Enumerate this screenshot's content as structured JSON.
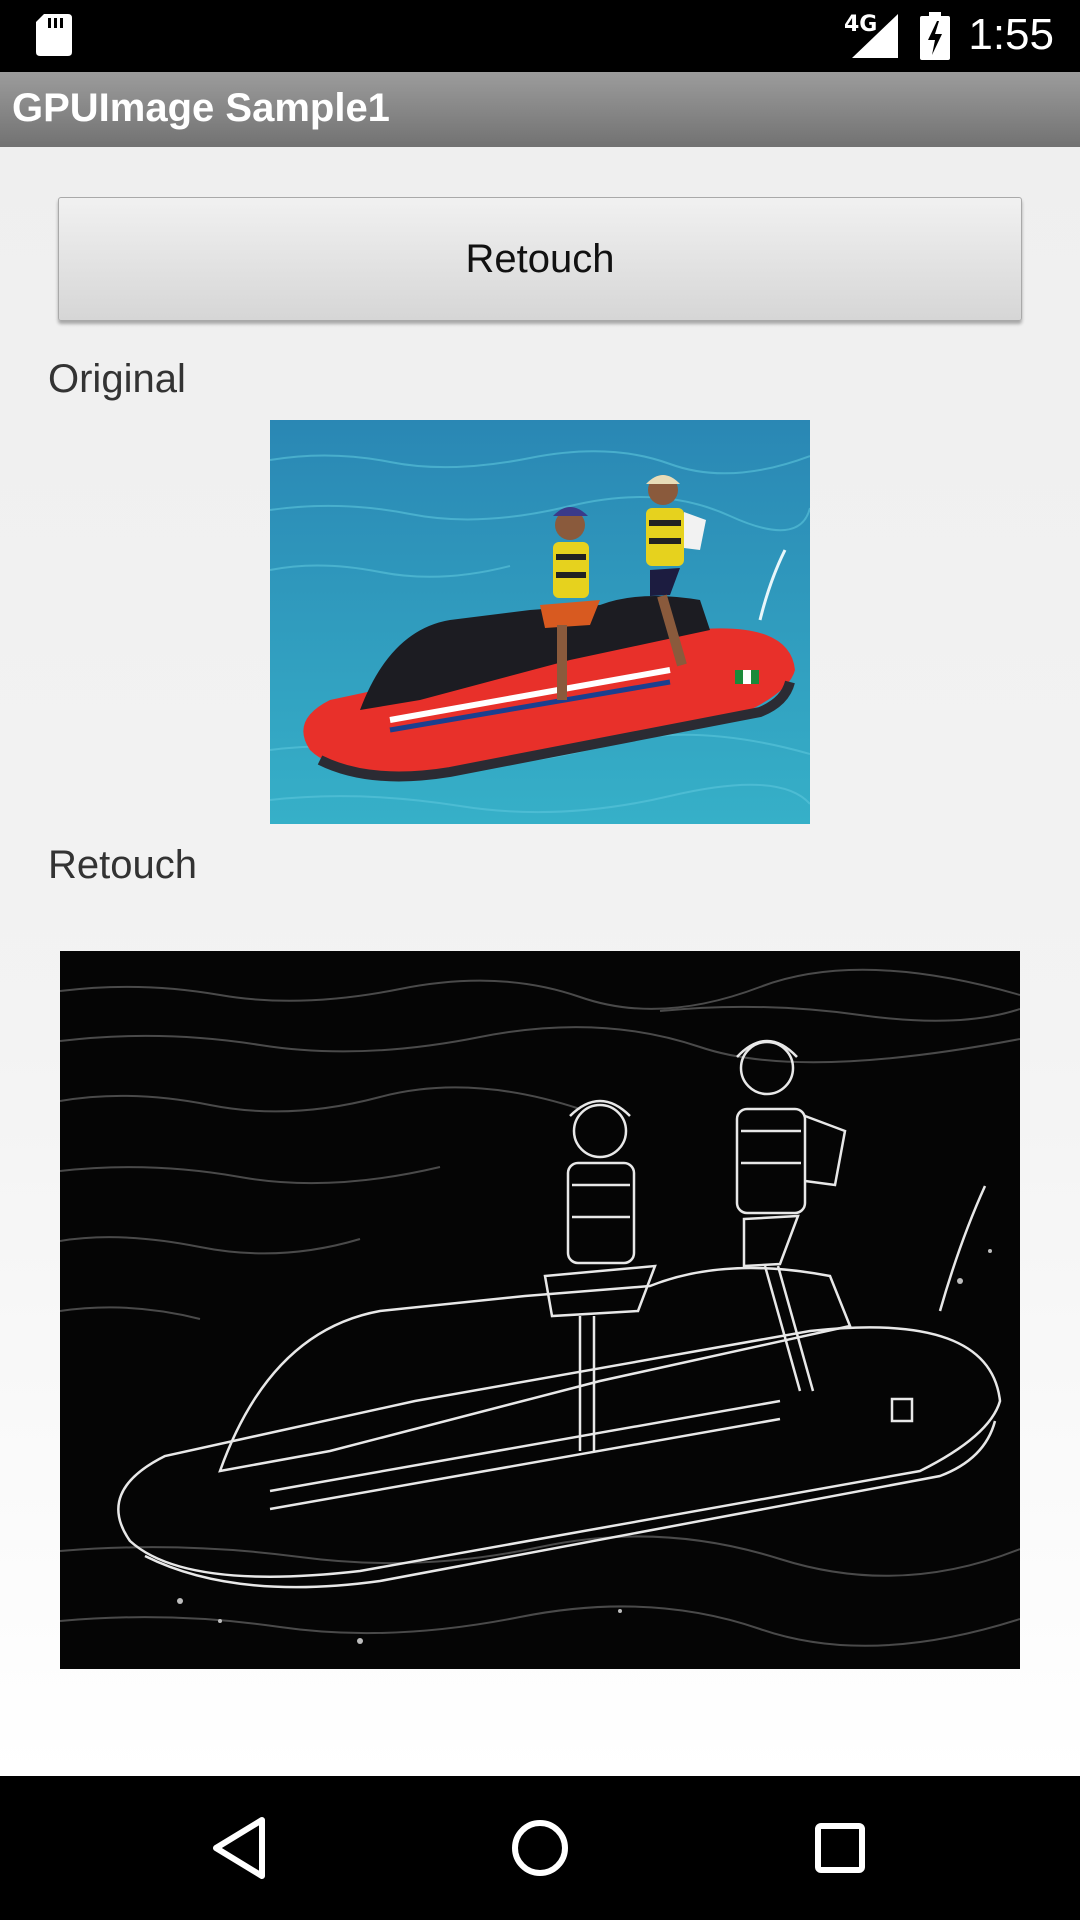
{
  "status_bar": {
    "network": "4G",
    "time": "1:55",
    "icons": [
      "sd-card-icon",
      "signal-icon",
      "battery-charging-icon"
    ]
  },
  "action_bar": {
    "title": "GPUImage Sample1"
  },
  "main": {
    "retouch_button_label": "Retouch",
    "original_label": "Original",
    "retouch_label": "Retouch"
  },
  "nav_bar": {
    "icons": [
      "back-icon",
      "home-icon",
      "recents-icon"
    ]
  },
  "colors": {
    "status_bar": "#000000",
    "action_bar": "#8a8a8a",
    "background": "#efefef",
    "water": "#2e9cc0",
    "jetski": "#e8302a"
  }
}
